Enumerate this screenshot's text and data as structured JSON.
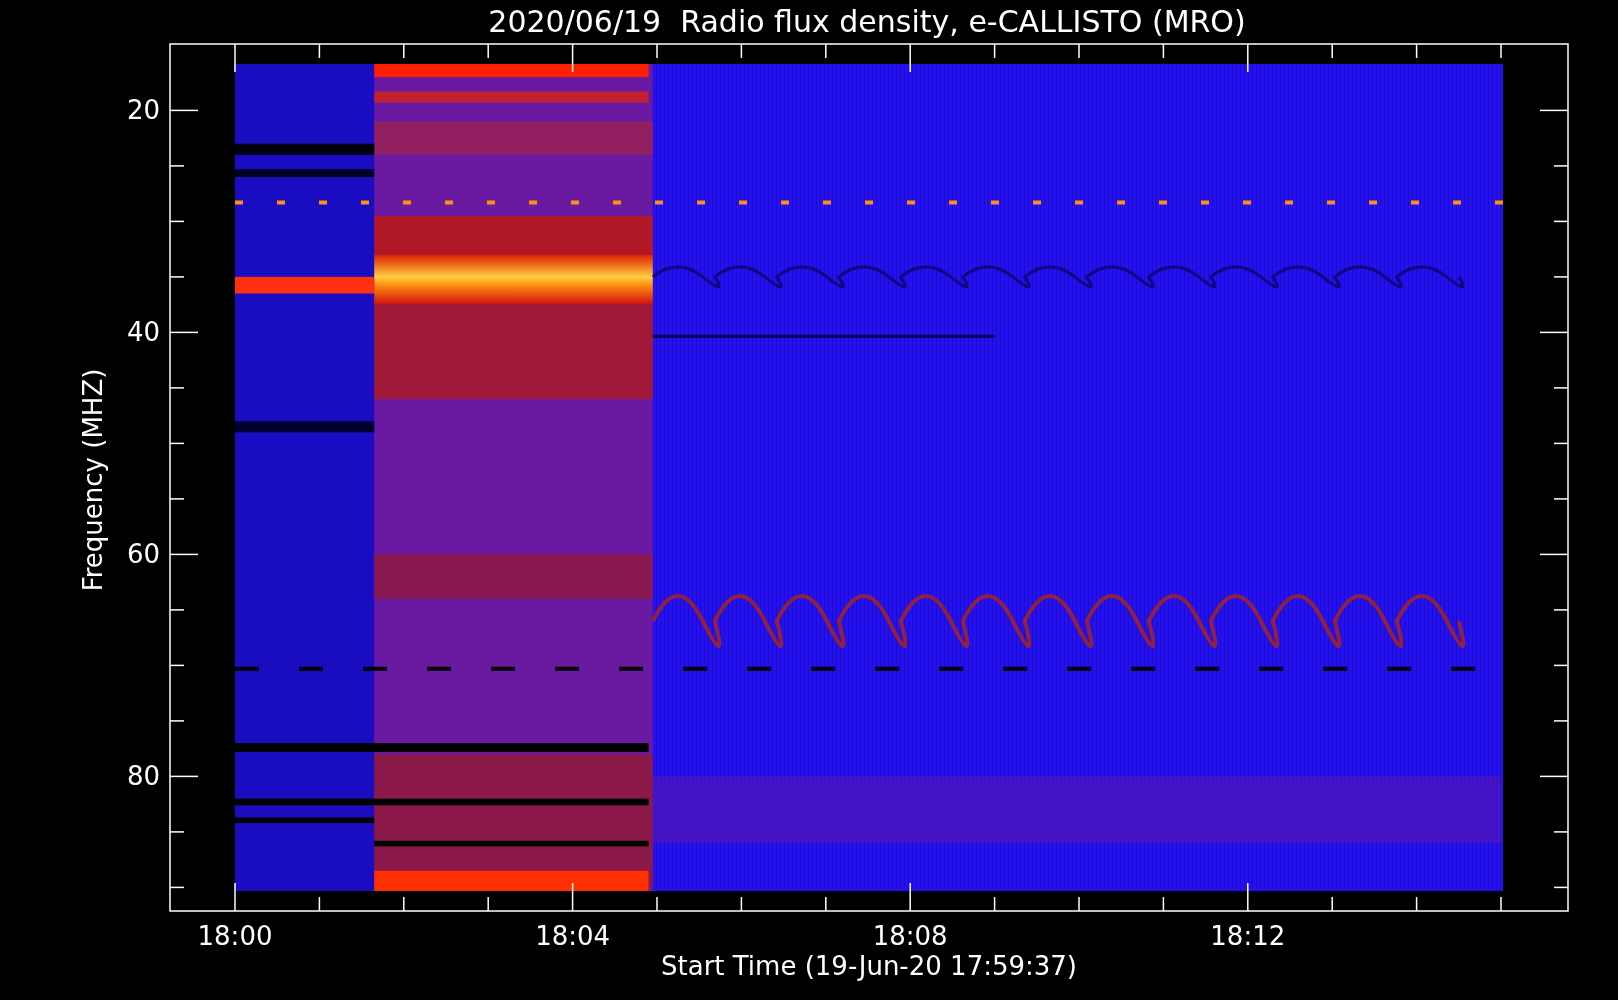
{
  "title": "2020/06/19  Radio flux density, e-CALLISTO (MRO)",
  "y_axis": {
    "label": "Frequency (MHZ)",
    "ticks": [
      "20",
      "40",
      "60",
      "80"
    ]
  },
  "x_axis": {
    "label": "Start Time (19-Jun-20 17:59:37)",
    "ticks": [
      "18:00",
      "18:04",
      "18:08",
      "18:12"
    ]
  }
}
